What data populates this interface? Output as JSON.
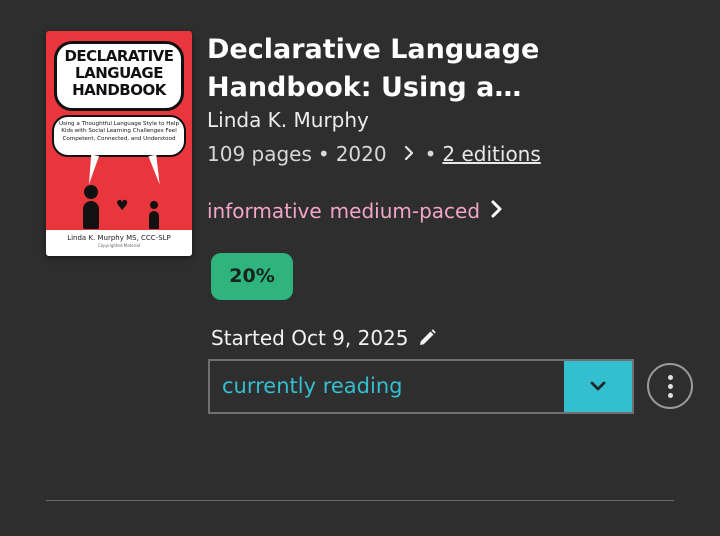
{
  "book": {
    "cover": {
      "headline_lines": [
        "DECLARATIVE",
        "LANGUAGE",
        "HANDBOOK"
      ],
      "subtitle": "Using a Thoughtful Language Style to Help Kids with Social Learning Challenges Feel Competent, Connected, and Understood",
      "author": "Linda K. Murphy MS, CCC-SLP",
      "copyright": "Copyrighted Material",
      "colors": {
        "background": "#e8363c"
      }
    },
    "title": "Declarative Language Handbook: Using a…",
    "author": "Linda K. Murphy",
    "pages": "109 pages",
    "separator": "•",
    "year": "2020",
    "editions_link": "2 editions",
    "moods": [
      "informative",
      "medium-paced"
    ],
    "progress": "20%",
    "started": "Started Oct 9, 2025",
    "status": "currently reading"
  },
  "icons": {
    "meta_chevron": "chevron-right-icon",
    "mood_chevron": "chevron-right-icon",
    "edit": "pencil-icon",
    "dropdown": "chevron-down-icon",
    "more": "more-vertical-icon"
  },
  "colors": {
    "background": "#2e2e2e",
    "mood_text": "#f3a5c8",
    "progress_badge": "#2fb47e",
    "status_accent": "#33bfd0"
  }
}
